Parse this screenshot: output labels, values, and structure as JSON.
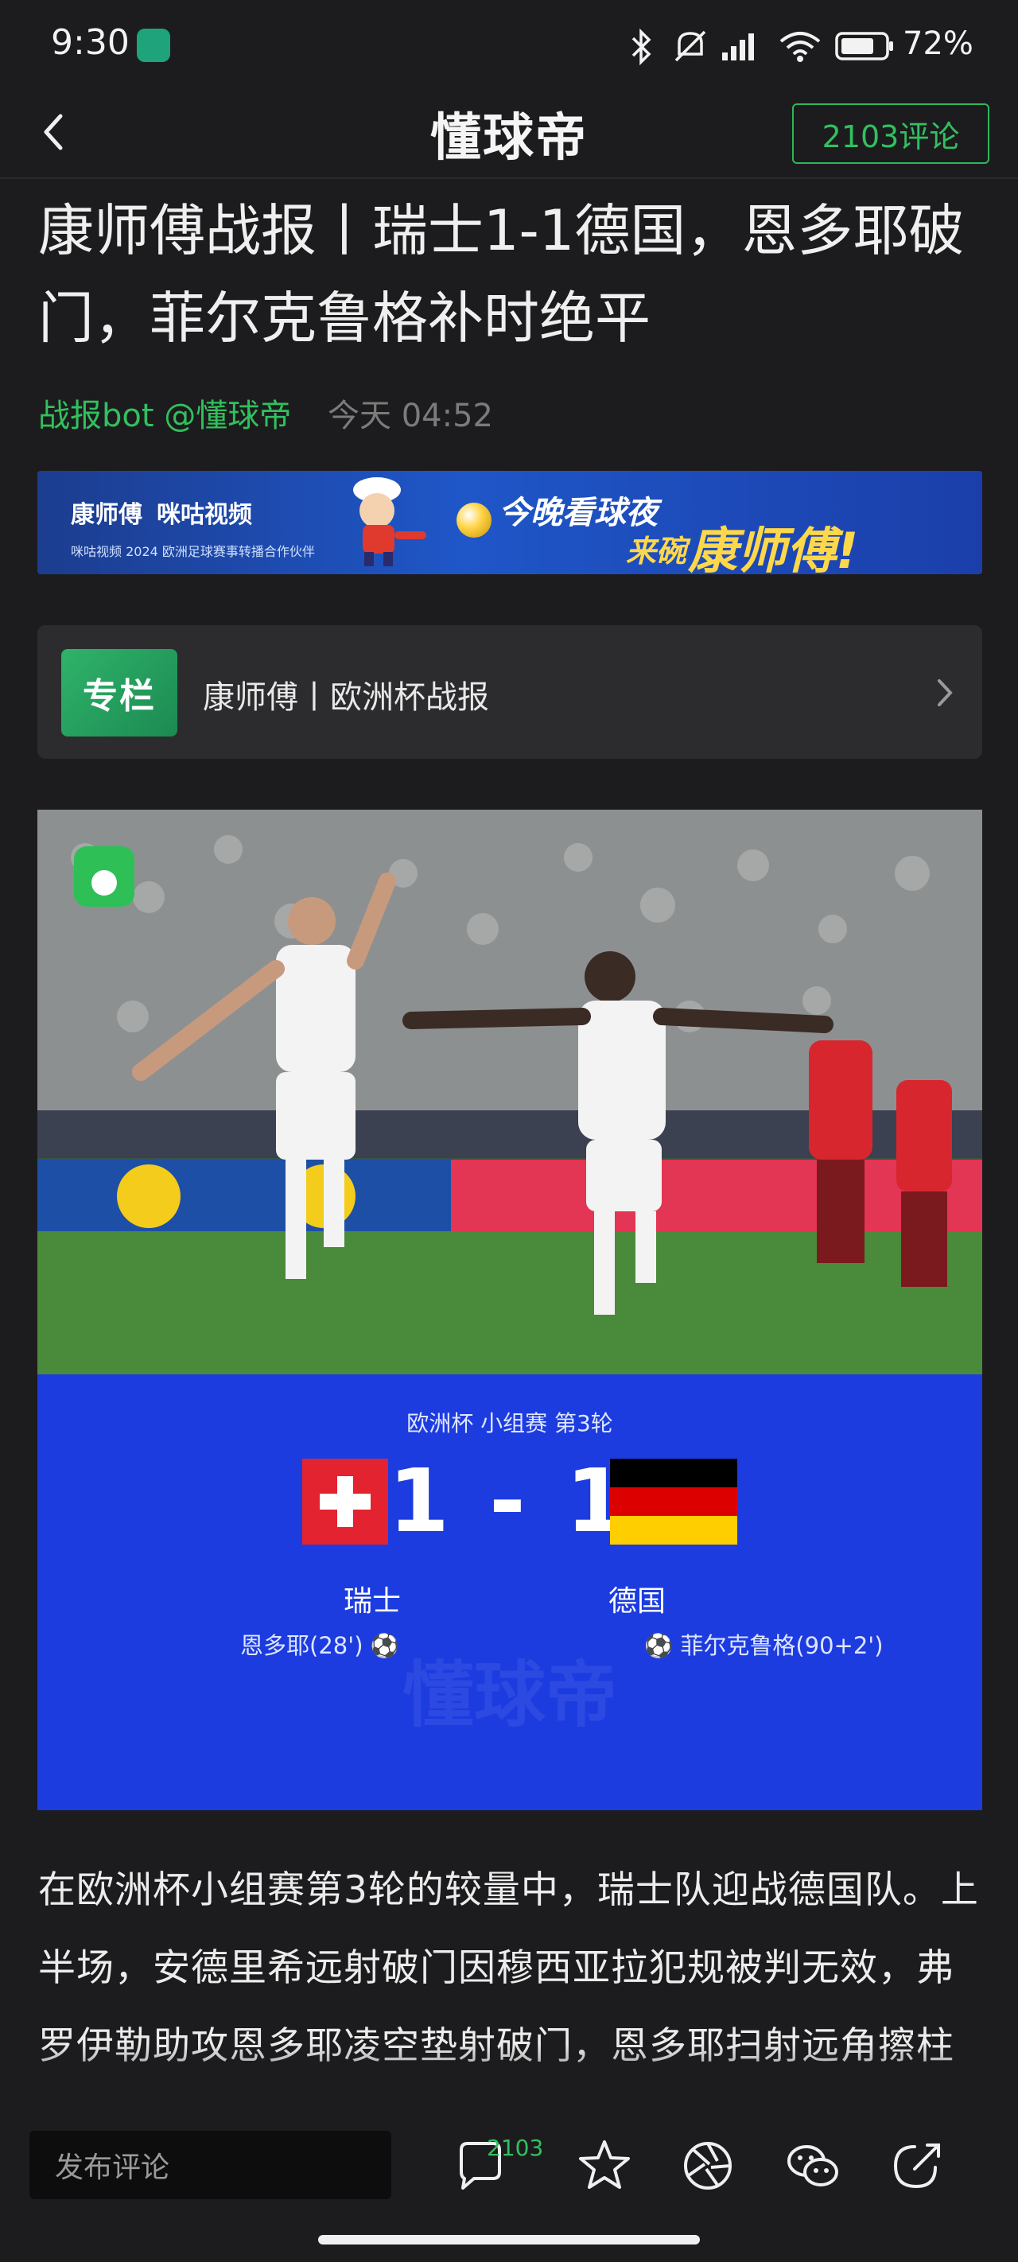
{
  "status_bar": {
    "time": "9:30",
    "battery": "72%"
  },
  "header": {
    "brand": "懂球帝",
    "comments_button": "2103评论"
  },
  "article": {
    "title": "康师傅战报丨瑞士1-1德国，恩多耶破门，菲尔克鲁格补时绝平",
    "author": "战报bot @懂球帝",
    "time": "今天 04:52",
    "body": "在欧洲杯小组赛第3轮的较量中，瑞士队迎战德国队。上半场，安德里希远射破门因穆西亚拉犯规被判无效，弗罗伊勒助攻恩多耶凌空垫射破门，恩多耶扫射远角擦柱而出；下半场，穆西亚拉抽射被韦"
  },
  "ad": {
    "brand_left": "康师傅",
    "brand_partner": "咪咕视频",
    "sub": "咪咕视频 2024 欧洲足球赛事转播合作伙伴",
    "tag_line1": "今晚看球夜",
    "tag_line2": "来碗",
    "tag_brand": "康师傅!"
  },
  "column": {
    "badge": "专栏",
    "label": "康师傅丨欧洲杯战报"
  },
  "scorecard": {
    "round": "欧洲杯 小组赛 第3轮",
    "score": "1 - 1",
    "team_home": "瑞士",
    "team_away": "德国",
    "scorer_home": "恩多耶(28') ⚽",
    "scorer_away": "⚽ 菲尔克鲁格(90+2')",
    "watermark": "懂球帝"
  },
  "bottom_bar": {
    "comment_placeholder": "发布评论",
    "comment_count": "2103"
  },
  "colors": {
    "accent_green": "#31c060",
    "scorecard_blue": "#1c3ce0",
    "background": "#1c1c1e"
  }
}
